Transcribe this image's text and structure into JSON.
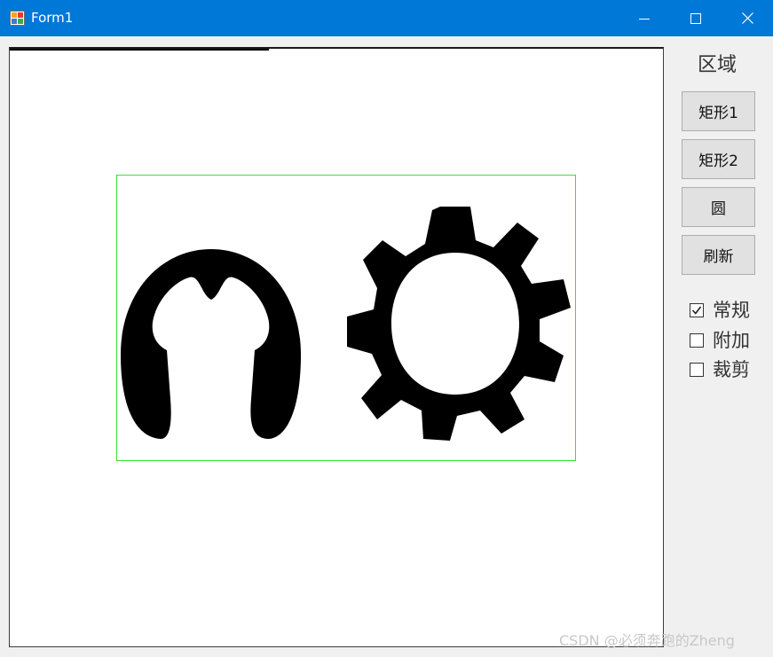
{
  "window": {
    "title": "Form1",
    "icon": "form-app-icon",
    "controls": {
      "minimize_icon": "minimize-icon",
      "maximize_icon": "maximize-icon",
      "close_icon": "close-icon"
    },
    "accent": "#0078d7"
  },
  "picture_box": {
    "roi_color": "#33e533",
    "shapes": [
      "e-clip-shape",
      "gear-shape"
    ]
  },
  "sidebar": {
    "region_label": "区域",
    "buttons": [
      {
        "label": "矩形1"
      },
      {
        "label": "矩形2"
      },
      {
        "label": "圆"
      },
      {
        "label": "刷新"
      }
    ],
    "checkboxes": [
      {
        "label": "常规",
        "checked": true
      },
      {
        "label": "附加",
        "checked": false
      },
      {
        "label": "裁剪",
        "checked": false
      }
    ]
  },
  "watermark": "CSDN @必须奔跑的Zheng"
}
